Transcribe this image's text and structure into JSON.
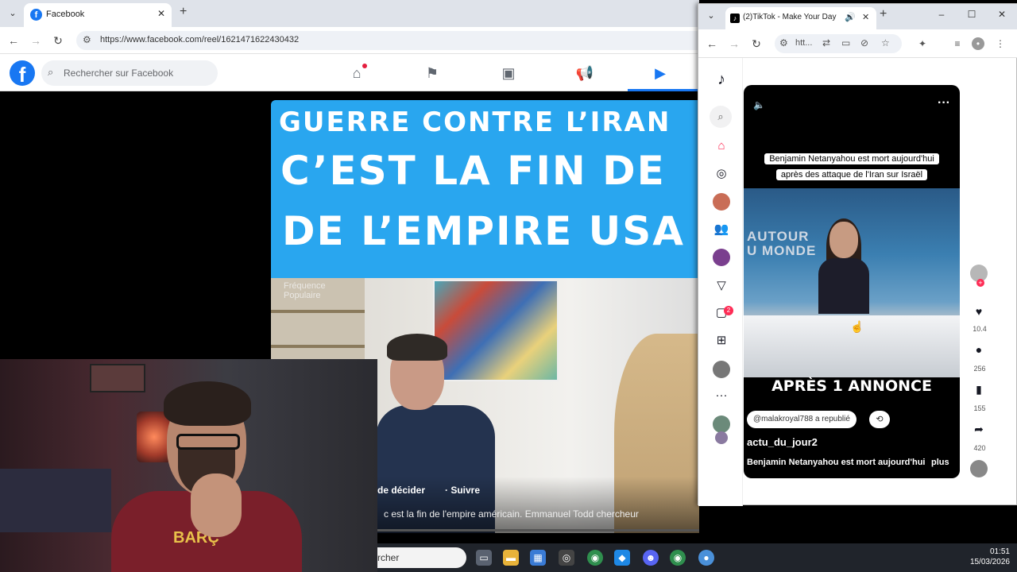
{
  "facebook": {
    "tab_title": "Facebook",
    "url": "https://www.facebook.com/reel/1621471622430432",
    "search_placeholder": "Rechercher sur Facebook",
    "reel": {
      "banner_line1": "GUERRE CONTRE L’IRAN",
      "banner_line2": "C’EST LA FIN DE",
      "banner_line3": "DE L’EMPIRE USA",
      "watermark_line1": "Fréquence",
      "watermark_line2": "Populaire",
      "author": "de décider",
      "follow": "· Suivre",
      "caption": "c est la fin de l'empire américain. Emmanuel Todd chercheur"
    }
  },
  "webcam": {
    "shirt_text": "BARÇ"
  },
  "taskbar": {
    "search_text": "rcher",
    "time": "01:51",
    "date": "15/03/2026"
  },
  "tiktok": {
    "tab_title": "(2)TikTok - Make Your Day",
    "url": "htt...",
    "message_badge": "2",
    "video": {
      "caption_line1": "Benjamin Netanyahou est mort aujourd'hui",
      "caption_line2": "après des attaque de l'Iran sur Israël",
      "news_brand_line1": "AUTOUR",
      "news_brand_line2": "U MONDE",
      "overlay_text": "APRÈS 1 ANNONCE",
      "repost_text": "@malakroyal788 a republié",
      "author": "actu_du_jour2",
      "description": "Benjamin Netanyahou est mort aujourd'hui",
      "more": "plus"
    },
    "actions": {
      "likes": "10.4",
      "comments": "256",
      "saves": "155",
      "shares": "420"
    }
  }
}
